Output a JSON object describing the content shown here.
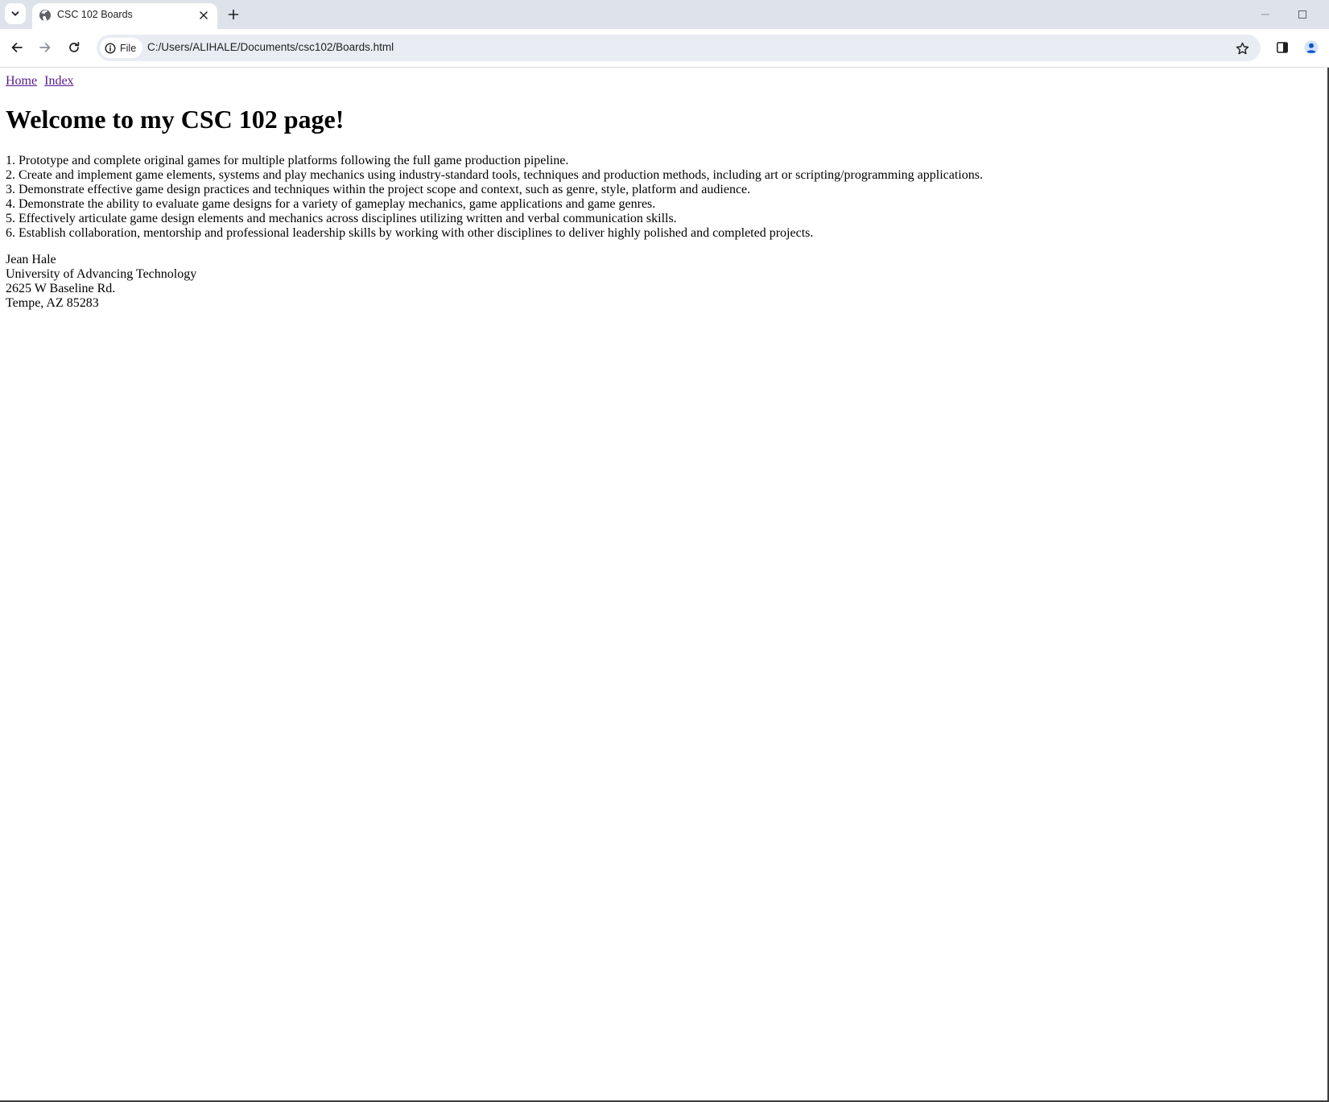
{
  "browser": {
    "tab": {
      "title": "CSC 102 Boards",
      "favicon": "globe-icon"
    },
    "omnibox": {
      "chip_label": "File",
      "url": "C:/Users/ALIHALE/Documents/csc102/Boards.html"
    },
    "icons": {
      "tab_search": "chevron-down-icon",
      "tab_close": "close-icon",
      "new_tab": "plus-icon",
      "minimize": "minimize-icon",
      "maximize": "maximize-icon",
      "back": "arrow-left-icon",
      "forward": "arrow-right-icon",
      "reload": "reload-icon",
      "site_info": "info-icon",
      "bookmark": "star-icon",
      "side_panel": "side-panel-icon",
      "profile": "profile-icon"
    },
    "colors": {
      "tabstrip": "#dee3eb",
      "omnibox": "#e9ecf3",
      "profile_accent": "#0b57d0",
      "visited_link": "#551a8b"
    }
  },
  "page": {
    "nav": {
      "home": "Home",
      "index": "Index"
    },
    "heading": "Welcome to my CSC 102 page!",
    "objectives": [
      "1. Prototype and complete original games for multiple platforms following the full game production pipeline.",
      "2. Create and implement game elements, systems and play mechanics using industry-standard tools, techniques and production methods, including art or scripting/programming applications.",
      "3. Demonstrate effective game design practices and techniques within the project scope and context, such as genre, style, platform and audience.",
      "4. Demonstrate the ability to evaluate game designs for a variety of gameplay mechanics, game applications and game genres.",
      "5. Effectively articulate game design elements and mechanics across disciplines utilizing written and verbal communication skills.",
      "6. Establish collaboration, mentorship and professional leadership skills by working with other disciplines to deliver highly polished and completed projects."
    ],
    "contact": {
      "name": "Jean Hale",
      "organization": "University of Advancing Technology",
      "street": "2625 W Baseline Rd.",
      "city_state_zip": "Tempe, AZ 85283"
    }
  }
}
